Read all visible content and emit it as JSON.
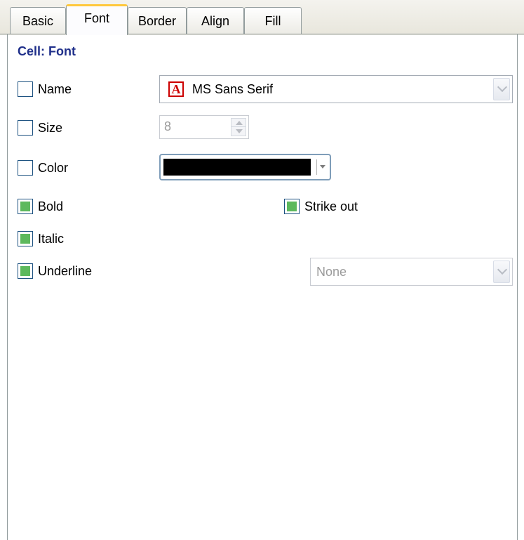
{
  "tabs": [
    {
      "label": "Basic"
    },
    {
      "label": "Font"
    },
    {
      "label": "Border"
    },
    {
      "label": "Align"
    },
    {
      "label": "Fill"
    }
  ],
  "active_tab": "Font",
  "heading": "Cell: Font",
  "fields": {
    "name": {
      "label": "Name",
      "checked": false,
      "value": "MS Sans Serif"
    },
    "size": {
      "label": "Size",
      "checked": false,
      "value": "8"
    },
    "color": {
      "label": "Color",
      "checked": false,
      "value": "#000000"
    },
    "bold": {
      "label": "Bold",
      "checked": true
    },
    "strike_out": {
      "label": "Strike out",
      "checked": true
    },
    "italic": {
      "label": "Italic",
      "checked": true
    },
    "underline": {
      "label": "Underline",
      "checked": true,
      "style_value": "None"
    }
  },
  "colors": {
    "heading": "#1f2f8a",
    "check_fill": "#5db95d",
    "active_tab_accent": "#ffc83c",
    "disabled_text": "#9a9a9a"
  }
}
